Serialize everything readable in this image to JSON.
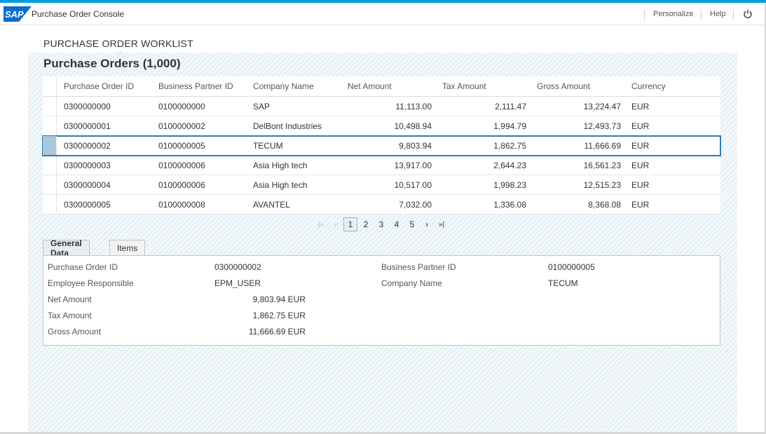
{
  "header": {
    "logo_text": "SAP",
    "app_title": "Purchase Order Console",
    "personalize": "Personalize",
    "help": "Help",
    "logout_icon": "power-icon"
  },
  "page": {
    "section_title": "PURCHASE ORDER WORKLIST",
    "table_title": "Purchase Orders (1,000)"
  },
  "table": {
    "columns": [
      "Purchase Order ID",
      "Business Partner ID",
      "Company Name",
      "Net Amount",
      "Tax Amount",
      "Gross Amount",
      "Currency"
    ],
    "rows": [
      {
        "id": "0300000000",
        "bp": "0100000000",
        "company": "SAP",
        "net": "11,113.00",
        "tax": "2,111.47",
        "gross": "13,224.47",
        "currency": "EUR"
      },
      {
        "id": "0300000001",
        "bp": "0100000002",
        "company": "DelBont Industries",
        "net": "10,498.94",
        "tax": "1,994.79",
        "gross": "12,493.73",
        "currency": "EUR"
      },
      {
        "id": "0300000002",
        "bp": "0100000005",
        "company": "TECUM",
        "net": "9,803.94",
        "tax": "1,862.75",
        "gross": "11,666.69",
        "currency": "EUR"
      },
      {
        "id": "0300000003",
        "bp": "0100000006",
        "company": "Asia High tech",
        "net": "13,917.00",
        "tax": "2,644.23",
        "gross": "16,561.23",
        "currency": "EUR"
      },
      {
        "id": "0300000004",
        "bp": "0100000006",
        "company": "Asia High tech",
        "net": "10,517.00",
        "tax": "1,998.23",
        "gross": "12,515.23",
        "currency": "EUR"
      },
      {
        "id": "0300000005",
        "bp": "0100000008",
        "company": "AVANTEL",
        "net": "7,032.00",
        "tax": "1,336.08",
        "gross": "8,368.08",
        "currency": "EUR"
      }
    ]
  },
  "pager": {
    "first": "|«",
    "prev": "‹",
    "pages": [
      "1",
      "2",
      "3",
      "4",
      "5"
    ],
    "current": "1",
    "next": "›",
    "last": "»|"
  },
  "tabs": {
    "general": "General Data",
    "items": "Items"
  },
  "details": {
    "po_id_label": "Purchase Order ID",
    "po_id_value": "0300000002",
    "emp_label": "Employee Responsible",
    "emp_value": "EPM_USER",
    "net_label": "Net Amount",
    "net_value": "9,803.94 EUR",
    "tax_label": "Tax Amount",
    "tax_value": "1,862.75 EUR",
    "gross_label": "Gross Amount",
    "gross_value": "11,666.69 EUR",
    "bp_label": "Business Partner ID",
    "bp_value": "0100000005",
    "company_label": "Company Name",
    "company_value": "TECUM"
  },
  "colors": {
    "accent": "#009de0",
    "selection": "#2e7cb4",
    "logo_blue": "#0a6ed1"
  }
}
